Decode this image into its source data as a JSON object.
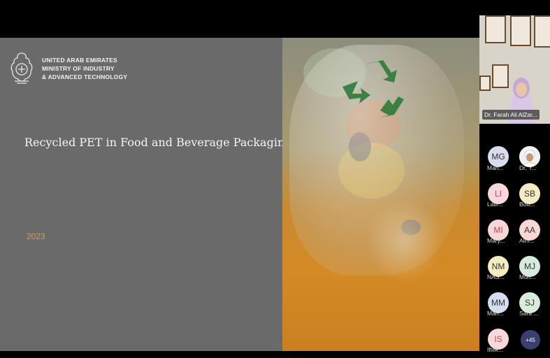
{
  "slide": {
    "ministry_lines": [
      "UNITED ARAB EMIRATES",
      "MINISTRY OF INDUSTRY",
      "& ADVANCED TECHNOLOGY"
    ],
    "title": "Recycled PET in Food and Beverage Packaging",
    "year": "2023"
  },
  "speaker": {
    "name": "Dr. Farah Ali AlZar..."
  },
  "participants": [
    {
      "initials": "MG",
      "name": "Man...",
      "color": "#d9dcee"
    },
    {
      "initials": "",
      "name": "Dr. Y...",
      "color": "#e9e9e9",
      "photo": true
    },
    {
      "initials": "LI",
      "name": "Latif...",
      "color": "#f7d9dc"
    },
    {
      "initials": "SB",
      "name": "Bou...",
      "color": "#f3ecc2"
    },
    {
      "initials": "MI",
      "name": "Mary...",
      "color": "#f7d6d8"
    },
    {
      "initials": "AA",
      "name": "Alm...",
      "color": "#f7d8d3"
    },
    {
      "initials": "NM",
      "name": "NAS...",
      "color": "#f4ebbf"
    },
    {
      "initials": "MJ",
      "name": "Moh...",
      "color": "#d6ebdc"
    },
    {
      "initials": "MM",
      "name": "Mari...",
      "color": "#d6dcef"
    },
    {
      "initials": "SJ",
      "name": "Sara ...",
      "color": "#d8ecdc"
    },
    {
      "initials": "IS",
      "name": "Iftek...",
      "color": "#f8d8da"
    }
  ],
  "more_count": "+45"
}
